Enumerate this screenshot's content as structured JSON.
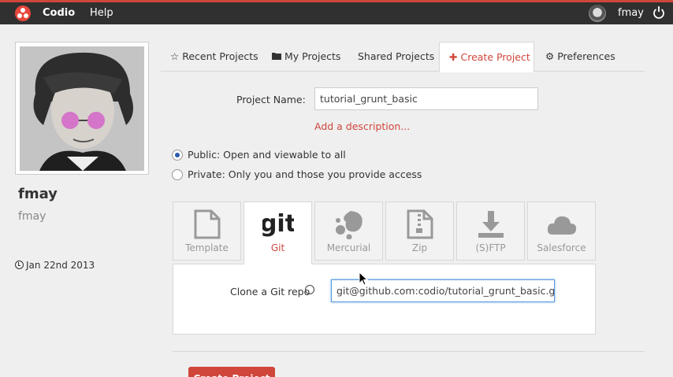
{
  "topbar": {
    "brand": "Codio",
    "help": "Help",
    "username": "fmay"
  },
  "profile": {
    "name": "fmay",
    "handle": "fmay",
    "joined": "Jan 22nd 2013"
  },
  "tabs": [
    {
      "label": "Recent Projects",
      "icon": "star-icon"
    },
    {
      "label": "My Projects",
      "icon": "folder-icon"
    },
    {
      "label": "Shared Projects",
      "icon": ""
    },
    {
      "label": "Create Project",
      "icon": "plus-icon",
      "active": true
    },
    {
      "label": "Preferences",
      "icon": "gear-icon"
    }
  ],
  "form": {
    "name_label": "Project Name:",
    "name_value": "tutorial_grunt_basic",
    "add_description": "Add a description...",
    "public_label": "Public: Open and viewable to all",
    "private_label": "Private: Only you and those you provide access",
    "visibility": "public"
  },
  "sources": [
    {
      "label": "Template",
      "icon": "file-icon"
    },
    {
      "label": "Git",
      "icon": "git-icon",
      "active": true
    },
    {
      "label": "Mercurial",
      "icon": "mercurial-icon"
    },
    {
      "label": "Zip",
      "icon": "zip-icon"
    },
    {
      "label": "(S)FTP",
      "icon": "download-icon"
    },
    {
      "label": "Salesforce",
      "icon": "cloud-icon"
    }
  ],
  "clone": {
    "label": "Clone a Git repo",
    "value": "git@github.com:codio/tutorial_grunt_basic.git"
  },
  "create_button": "Create Project",
  "colors": {
    "accent": "#d0463b",
    "topbar": "#303030",
    "focus": "#5b9be0"
  }
}
